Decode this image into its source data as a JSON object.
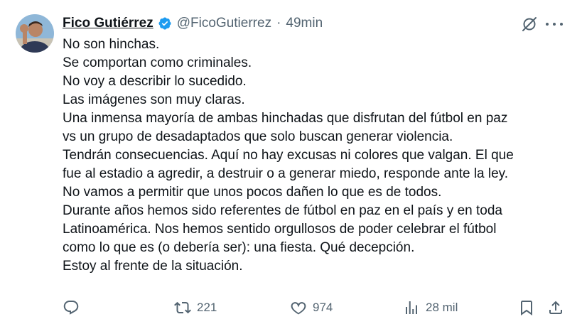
{
  "author": {
    "name": "Fico Gutiérrez",
    "handle": "@FicoGutierrez",
    "separator": "·",
    "time": "49min"
  },
  "tweet": {
    "lines": [
      "No son hinchas.",
      "Se comportan como criminales.",
      "No voy a describir lo sucedido.",
      "Las imágenes son muy claras.",
      "Una inmensa mayoría de ambas hinchadas que disfrutan del fútbol en paz",
      "vs un grupo de desadaptados que solo buscan generar violencia.",
      "Tendrán consecuencias. Aquí no hay excusas ni colores que valgan. El que",
      "fue al estadio a agredir, a destruir o a generar miedo, responde ante la ley.",
      "No vamos a permitir que unos pocos dañen lo que es de todos.",
      "Durante años hemos sido referentes de fútbol en paz en el país y en toda",
      "Latinoamérica. Nos hemos sentido orgullosos de poder celebrar el fútbol",
      "como lo que es (o debería ser): una fiesta. Qué decepción.",
      "Estoy al frente de la situación."
    ]
  },
  "metrics": {
    "retweets": "221",
    "likes": "974",
    "views": "28 mil"
  },
  "icons": {
    "verified": "verified-badge-icon",
    "grok": "grok-icon",
    "more": "more-options-icon",
    "reply": "reply-icon",
    "retweet": "retweet-icon",
    "like": "heart-icon",
    "views": "views-icon",
    "bookmark": "bookmark-icon",
    "share": "share-icon"
  },
  "colors": {
    "text": "#0f1419",
    "secondary": "#536471",
    "verified": "#1d9bf0"
  }
}
